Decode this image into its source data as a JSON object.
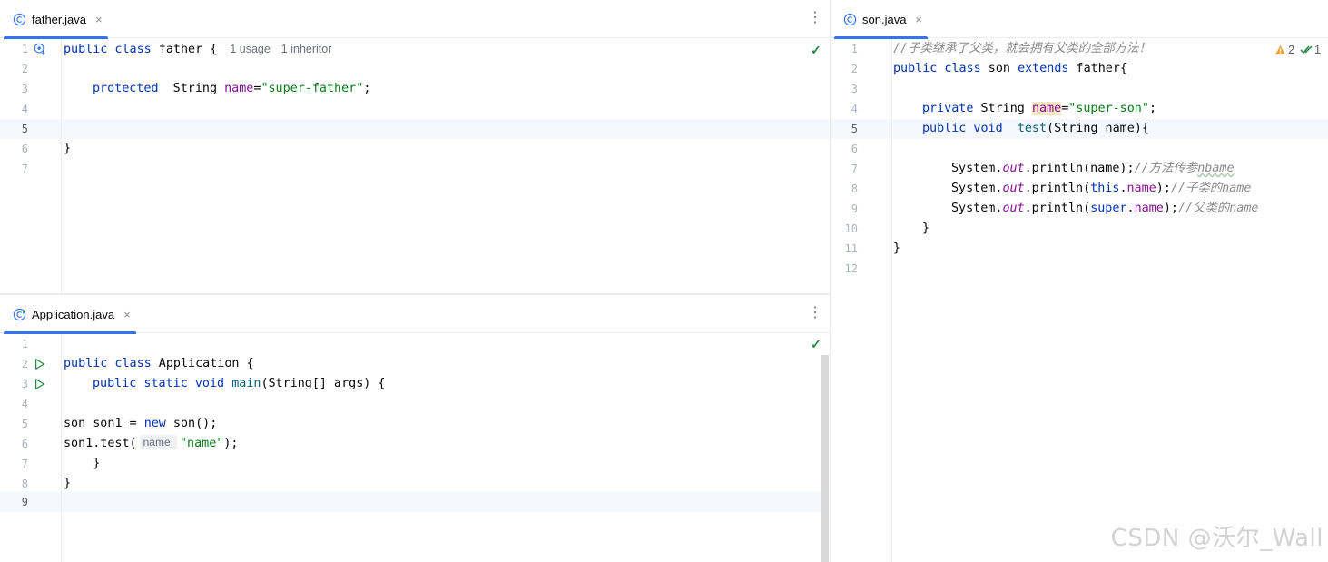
{
  "father_pane": {
    "tab_title": "father.java",
    "close_glyph": "×",
    "menu_glyph": "⋮",
    "icon": "class-c-icon",
    "line_numbers": [
      "1",
      "2",
      "3",
      "4",
      "5",
      "6",
      "7"
    ],
    "code": {
      "l1_kw": "public class",
      "l1_name": " father {",
      "l1_usage": "1 usage",
      "l1_inheritor": "1 inheritor",
      "l3_kw": "protected",
      "l3_type": "  String ",
      "l3_field": "name",
      "l3_eq": "=",
      "l3_str": "\"super-father\"",
      "l3_end": ";",
      "l6": "}"
    },
    "status_glyph": "✓"
  },
  "app_pane": {
    "tab_title": "Application.java",
    "close_glyph": "×",
    "menu_glyph": "⋮",
    "icon": "main-class-icon",
    "line_numbers": [
      "1",
      "2",
      "3",
      "4",
      "5",
      "6",
      "7",
      "8",
      "9"
    ],
    "code": {
      "l2_kw": "public class",
      "l2_name": " Application {",
      "l3_kw": "public static void",
      "l3_fn": "main",
      "l3_rest": "(String[] args) {",
      "l5_a": "son son1 = ",
      "l5_kw": "new",
      "l5_b": " son();",
      "l6_a": "son1.test(",
      "l6_hint": "name:",
      "l6_str": "\"name\"",
      "l6_end": ");",
      "l7": "    }",
      "l8": "}"
    },
    "status_glyph": "✓"
  },
  "son_pane": {
    "tab_title": "son.java",
    "close_glyph": "×",
    "icon": "class-c-icon",
    "line_numbers": [
      "1",
      "2",
      "3",
      "4",
      "5",
      "6",
      "7",
      "8",
      "9",
      "10",
      "11",
      "12"
    ],
    "inspections": {
      "warnings": "2",
      "checks": "1"
    },
    "code": {
      "l1_cmt": "//子类继承了父类，就会拥有父类的全部方法！",
      "l2_kw": "public class",
      "l2_name": " son ",
      "l2_kw2": "extends",
      "l2_rest": " father{",
      "l4_kw": "private",
      "l4_type": " String ",
      "l4_field": "name",
      "l4_eq": "=",
      "l4_str": "\"super-son\"",
      "l4_end": ";",
      "l5_kw": "public void",
      "l5_fn": "test",
      "l5_rest": "(String name){",
      "l7_a": "System.",
      "l7_out": "out",
      "l7_b": ".println(name);",
      "l7_cmt": "//方法传参",
      "l7_cmt2": "nbame",
      "l8_a": "System.",
      "l8_out": "out",
      "l8_b": ".println(",
      "l8_kw": "this",
      "l8_c": ".",
      "l8_field": "name",
      "l8_d": ");",
      "l8_cmt": "//子类的name",
      "l9_a": "System.",
      "l9_out": "out",
      "l9_b": ".println(",
      "l9_kw": "super",
      "l9_c": ".",
      "l9_field": "name",
      "l9_d": ");",
      "l9_cmt": "//父类的name",
      "l10": "}",
      "l11": "}"
    }
  },
  "watermark": "CSDN @沃尔_Wall",
  "colors": {
    "keyword": "#0033b3",
    "string": "#067d17",
    "field": "#871094",
    "function": "#00627a",
    "comment": "#8c8c8c",
    "accent": "#3574f0",
    "ok": "#208a3c",
    "warning": "#e8a33d"
  }
}
